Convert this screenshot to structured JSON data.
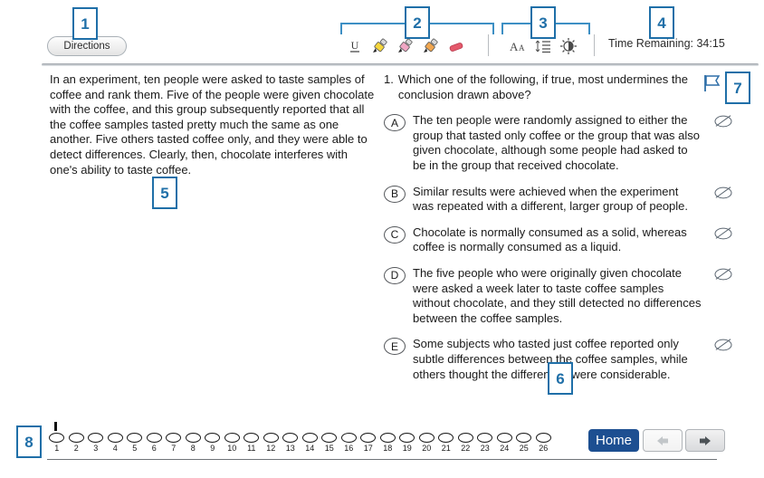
{
  "toolbar": {
    "directions_label": "Directions",
    "annotation_tools": [
      {
        "name": "underline-tool",
        "glyph": "U"
      },
      {
        "name": "highlighter-yellow-tool",
        "color": "#f5d63d"
      },
      {
        "name": "highlighter-pink-tool",
        "color": "#f0a7c4"
      },
      {
        "name": "highlighter-orange-tool",
        "color": "#f0a650"
      },
      {
        "name": "eraser-tool",
        "color": "#e4596b"
      }
    ],
    "display_tools": [
      {
        "name": "font-size-tool",
        "glyph": "Aa"
      },
      {
        "name": "line-spacing-tool",
        "glyph": "line-spacing"
      },
      {
        "name": "brightness-tool",
        "glyph": "brightness"
      }
    ],
    "timer_label": "Time Remaining: 34:15"
  },
  "passage": {
    "text": "In an experiment, ten people were asked to taste samples of coffee and rank them. Five of the people were given chocolate with the coffee, and this group subsequently reported that all the coffee samples tasted pretty much the same as one another. Five others tasted coffee only, and they were able to detect differences. Clearly, then, chocolate interferes with one's ability to taste coffee."
  },
  "question": {
    "number": "1.",
    "stem": "Which one of the following, if true, most undermines the conclusion drawn above?",
    "choices": [
      {
        "letter": "A",
        "text": "The ten people were randomly assigned to either the group that tasted only coffee or the group that was also given chocolate, although some people had asked to be in the group that received chocolate."
      },
      {
        "letter": "B",
        "text": "Similar results were achieved when the experiment was repeated with a different, larger group of people."
      },
      {
        "letter": "C",
        "text": "Chocolate is normally consumed as a solid, whereas coffee is normally consumed as a liquid."
      },
      {
        "letter": "D",
        "text": "The five people who were originally given chocolate were asked a week later to taste coffee samples without chocolate, and they still detected no differences between the coffee samples."
      },
      {
        "letter": "E",
        "text": "Some subjects who tasted just coffee reported only subtle differences between the coffee samples, while others thought the differences were considerable."
      }
    ]
  },
  "navigation": {
    "question_numbers": [
      "1",
      "2",
      "3",
      "4",
      "5",
      "6",
      "7",
      "8",
      "9",
      "10",
      "11",
      "12",
      "13",
      "14",
      "15",
      "16",
      "17",
      "18",
      "19",
      "20",
      "21",
      "22",
      "23",
      "24",
      "25",
      "26"
    ],
    "current_question": "1",
    "home_label": "Home",
    "prev_label": "◄",
    "next_label": "►"
  },
  "annotations": [
    {
      "id": "1",
      "label": "1"
    },
    {
      "id": "2",
      "label": "2"
    },
    {
      "id": "3",
      "label": "3"
    },
    {
      "id": "4",
      "label": "4"
    },
    {
      "id": "5",
      "label": "5"
    },
    {
      "id": "6",
      "label": "6"
    },
    {
      "id": "7",
      "label": "7"
    },
    {
      "id": "8",
      "label": "8"
    }
  ],
  "colors": {
    "accent_blue": "#1f6fa8",
    "home_blue": "#1d4f91",
    "flag_blue": "#2f6fa8",
    "text": "#1a1a1a"
  }
}
